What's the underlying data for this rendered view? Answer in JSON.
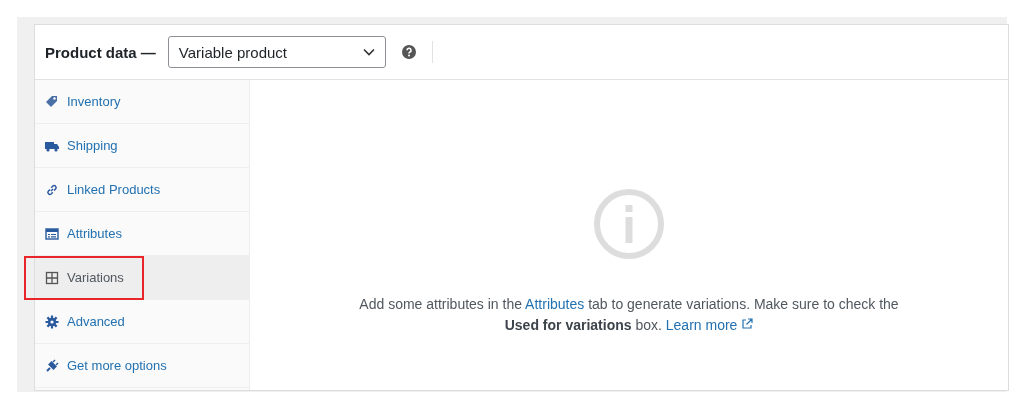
{
  "header": {
    "title": "Product data —",
    "product_type": "Variable product"
  },
  "sidebar": {
    "items": [
      {
        "label": "Inventory",
        "selected": false,
        "highlighted": false
      },
      {
        "label": "Shipping",
        "selected": false,
        "highlighted": false
      },
      {
        "label": "Linked Products",
        "selected": false,
        "highlighted": false
      },
      {
        "label": "Attributes",
        "selected": false,
        "highlighted": false
      },
      {
        "label": "Variations",
        "selected": true,
        "highlighted": true
      },
      {
        "label": "Advanced",
        "selected": false,
        "highlighted": false
      },
      {
        "label": "Get more options",
        "selected": false,
        "highlighted": false
      }
    ]
  },
  "notice": {
    "parts": [
      {
        "kind": "text",
        "text": "Add some attributes in the "
      },
      {
        "kind": "link",
        "text": "Attributes"
      },
      {
        "kind": "text",
        "text": " tab to generate variations. Make sure to check the **Used for variations** box. "
      },
      {
        "kind": "external_link",
        "text": "Learn more"
      }
    ]
  }
}
